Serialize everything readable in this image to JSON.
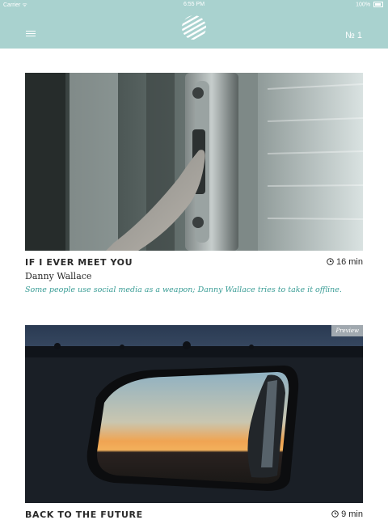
{
  "status_bar": {
    "carrier": "Carrier ᯤ",
    "time": "6:55 PM",
    "battery": "100%"
  },
  "nav": {
    "issue_label": "№ 1"
  },
  "colors": {
    "accent": "#a9d2cf",
    "link": "#3a9d96"
  },
  "icons": {
    "menu": "hamburger-icon",
    "logo": "striped-circle-logo",
    "clock": "clock-icon"
  },
  "stories": [
    {
      "title": "IF I EVER MEET YOU",
      "duration": "16 min",
      "author": "Danny Wallace",
      "summary": "Some people use social media as a weapon; Danny Wallace tries to take it offline."
    },
    {
      "title": "BACK TO THE FUTURE",
      "duration": "9 min",
      "badge": "Preview"
    }
  ]
}
